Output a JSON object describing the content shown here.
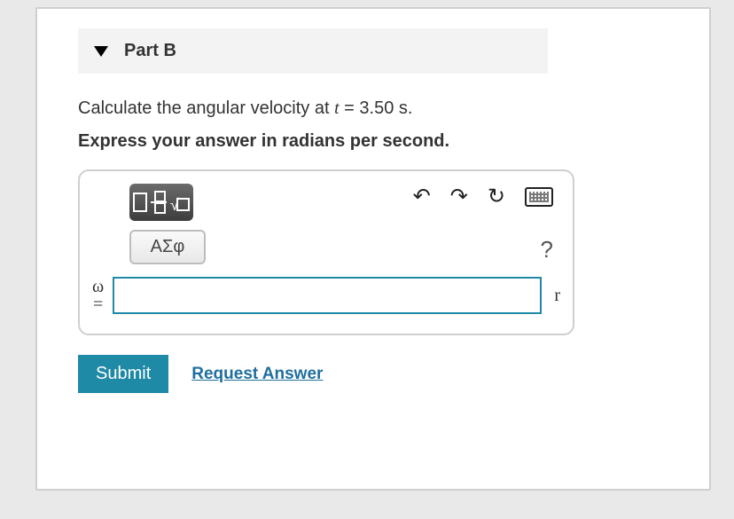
{
  "part": {
    "label": "Part B"
  },
  "question": {
    "text_before": "Calculate the angular velocity at ",
    "variable": "t",
    "equals": " = 3.50 s.",
    "instruction": "Express your answer in radians per second."
  },
  "toolbar": {
    "greek_label": "ΑΣφ",
    "help_label": "?"
  },
  "answer": {
    "symbol": "ω",
    "eq": "=",
    "value": "",
    "unit": "r"
  },
  "actions": {
    "submit": "Submit",
    "request": "Request Answer"
  }
}
